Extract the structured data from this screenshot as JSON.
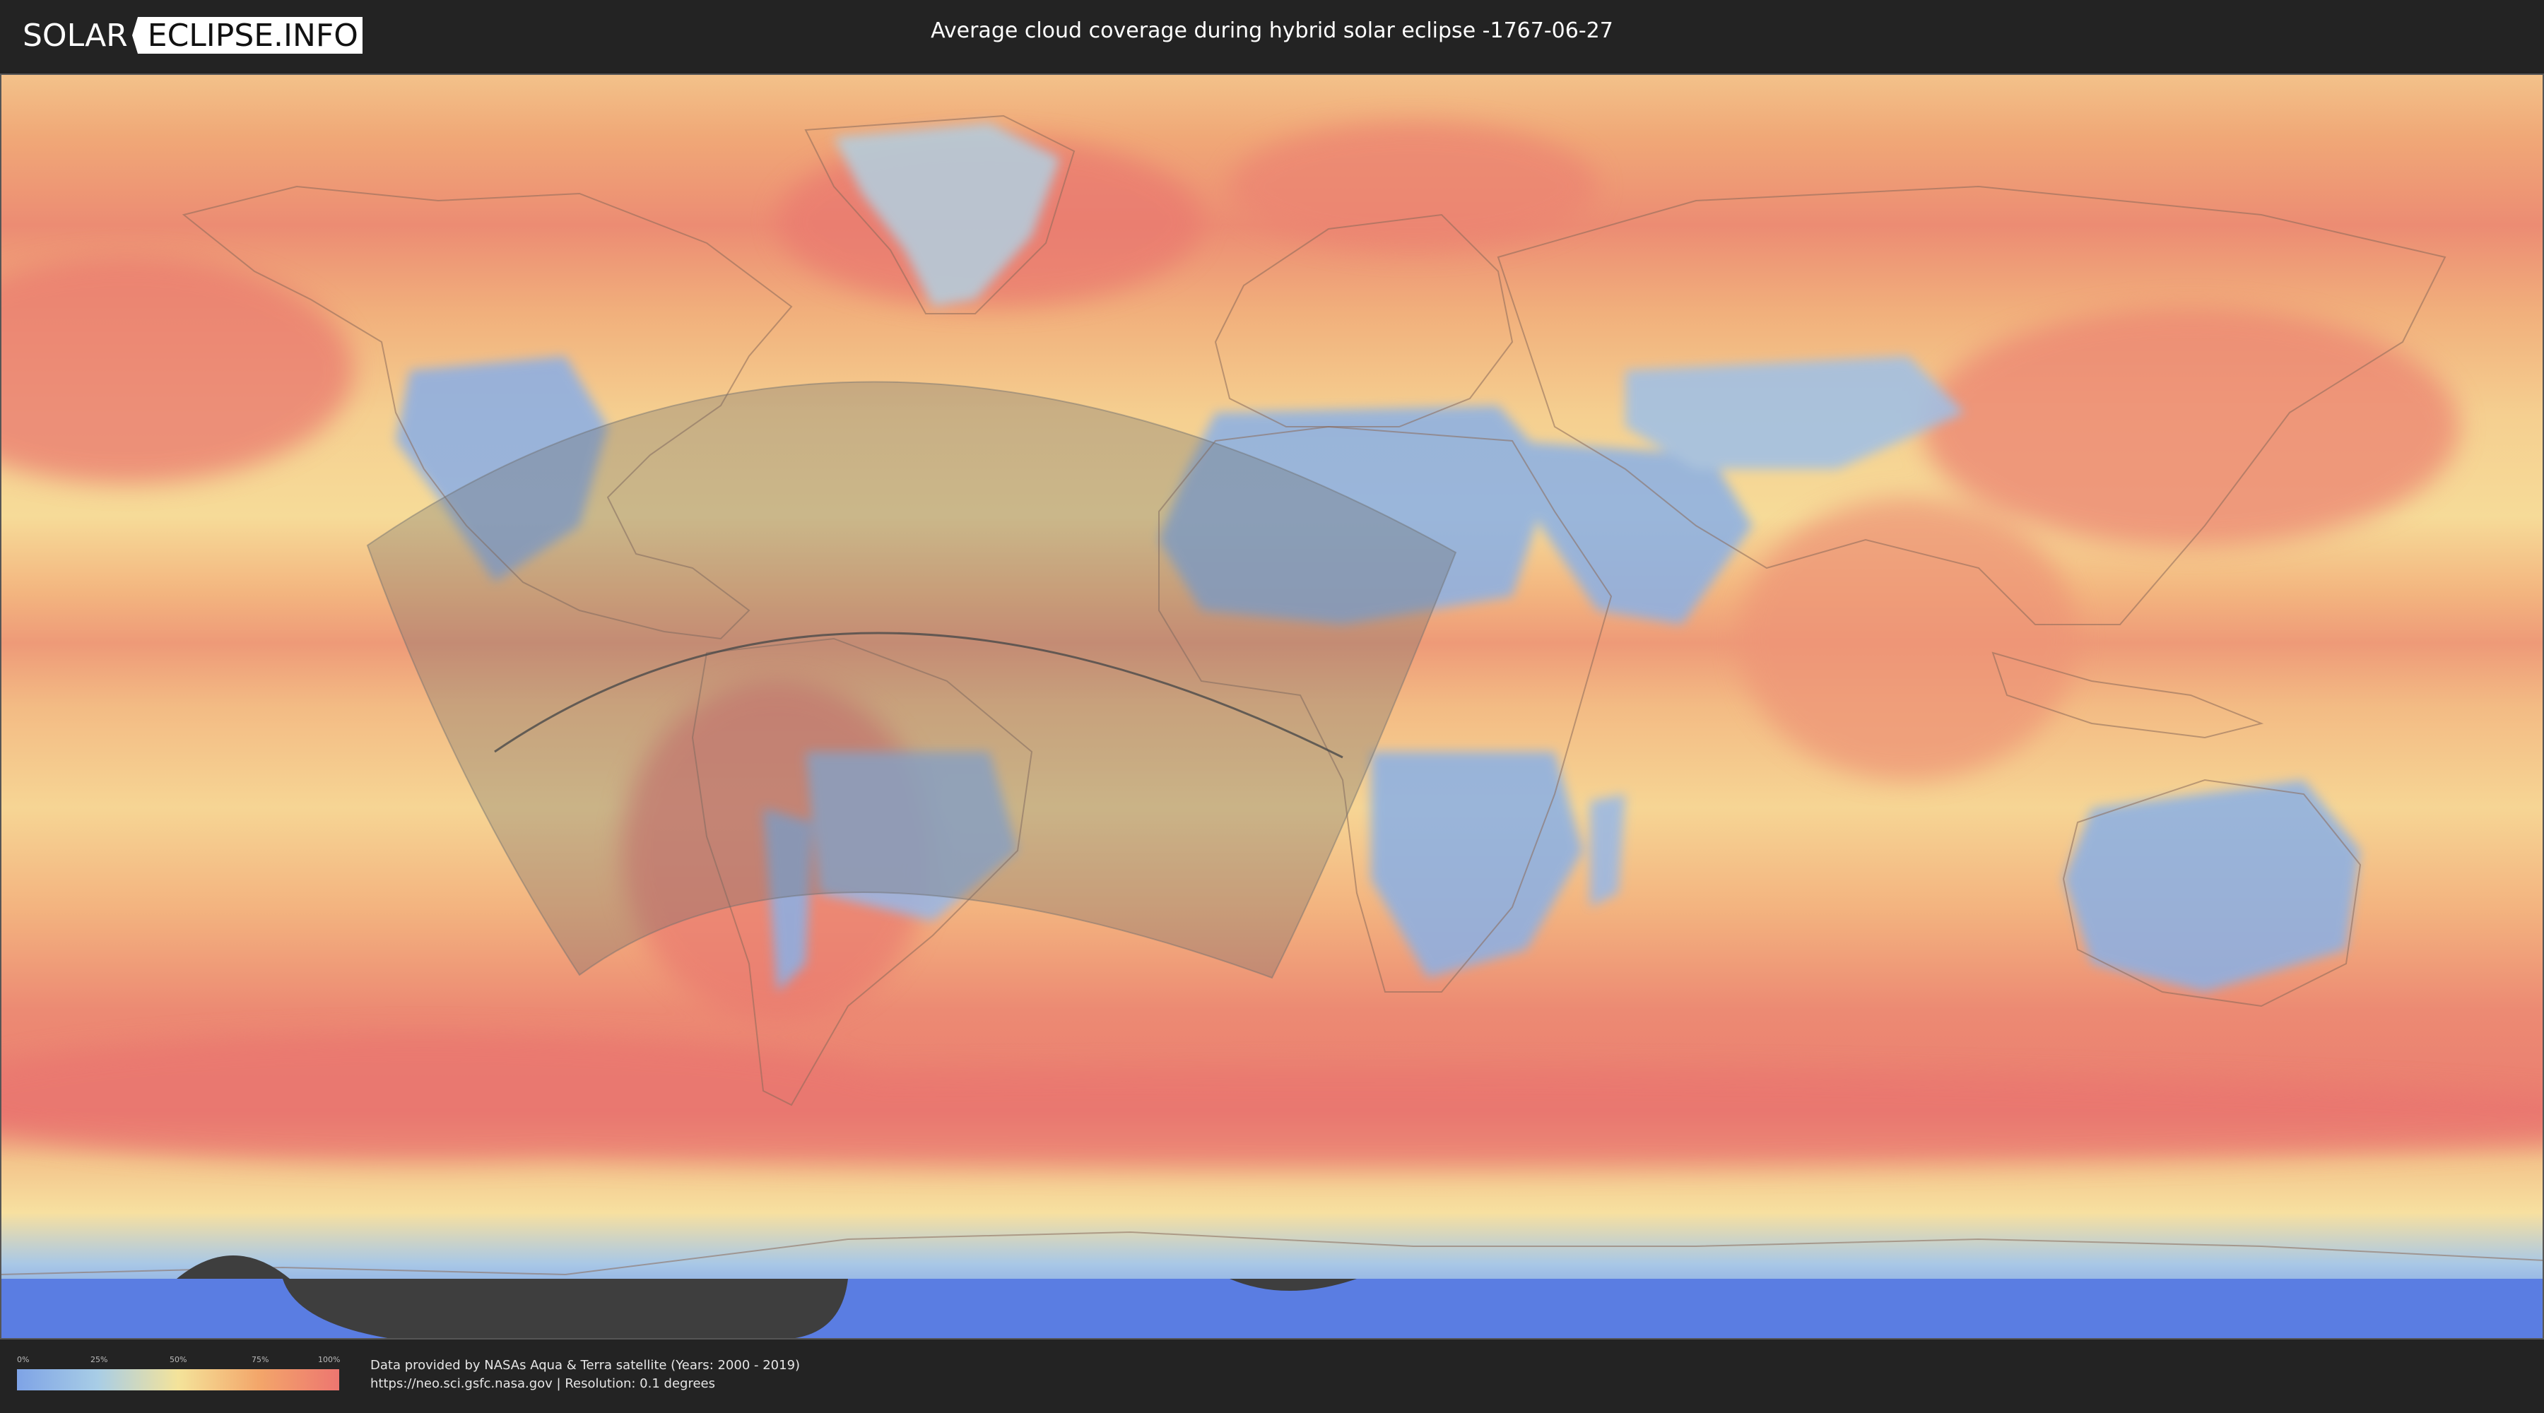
{
  "header": {
    "logo_part1": "SOLAR",
    "logo_part2": "ECLIPSE.INFO",
    "title": "Average cloud coverage during hybrid solar eclipse -1767-06-27"
  },
  "legend": {
    "ticks": [
      "0%",
      "25%",
      "50%",
      "75%",
      "100%"
    ],
    "colors": [
      "#7ea3e6",
      "#a8cde6",
      "#f4e39a",
      "#f3a66a",
      "#ed7670"
    ]
  },
  "footer": {
    "credit_line1": "Data provided by NASAs Aqua & Terra satellite (Years: 2000 - 2019)",
    "credit_line2": "https://neo.sci.gsfc.nasa.gov | Resolution: 0.1 degrees"
  },
  "map": {
    "projection": "equirectangular",
    "layer": "cloud-coverage",
    "overlay": "eclipse-visibility-zone",
    "path": "central-eclipse-path"
  }
}
